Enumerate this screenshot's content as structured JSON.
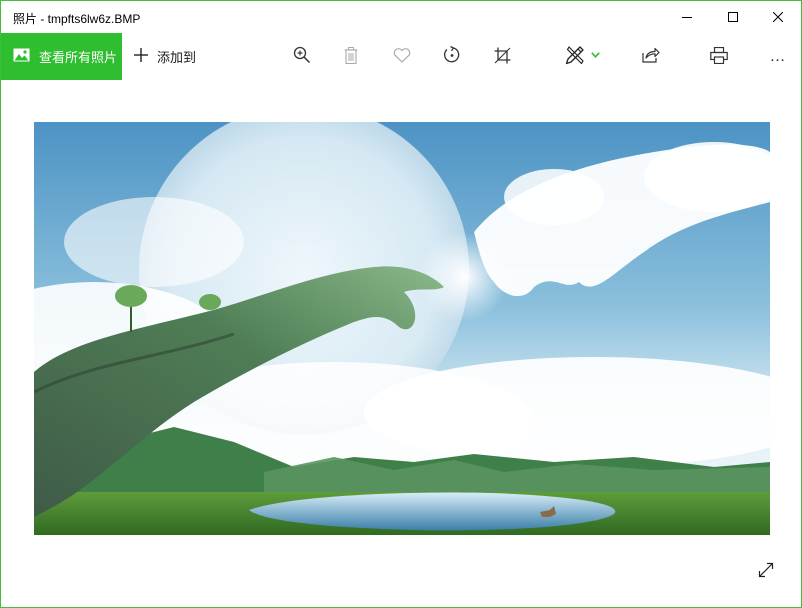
{
  "window": {
    "title": "照片 - tmpfts6lw6z.BMP",
    "accent_color": "#2fbe2f",
    "border_color": "#3fbf3f",
    "controls": {
      "minimize_icon": "minimize-icon",
      "maximize_icon": "maximize-icon",
      "close_icon": "close-icon"
    }
  },
  "toolbar": {
    "view_all_label": "查看所有照片",
    "view_all_icon": "image-icon",
    "add_to_label": "添加到",
    "add_to_icon": "plus-icon",
    "tools": [
      "zoom-in-icon",
      "delete-icon",
      "favorite-icon",
      "rotate-icon",
      "crop-icon",
      "edit-draw-icon",
      "share-icon",
      "print-icon"
    ],
    "more_label": "…"
  },
  "photo": {
    "icon": "photo-image",
    "fullscreen_icon": "fullscreen-icon"
  }
}
